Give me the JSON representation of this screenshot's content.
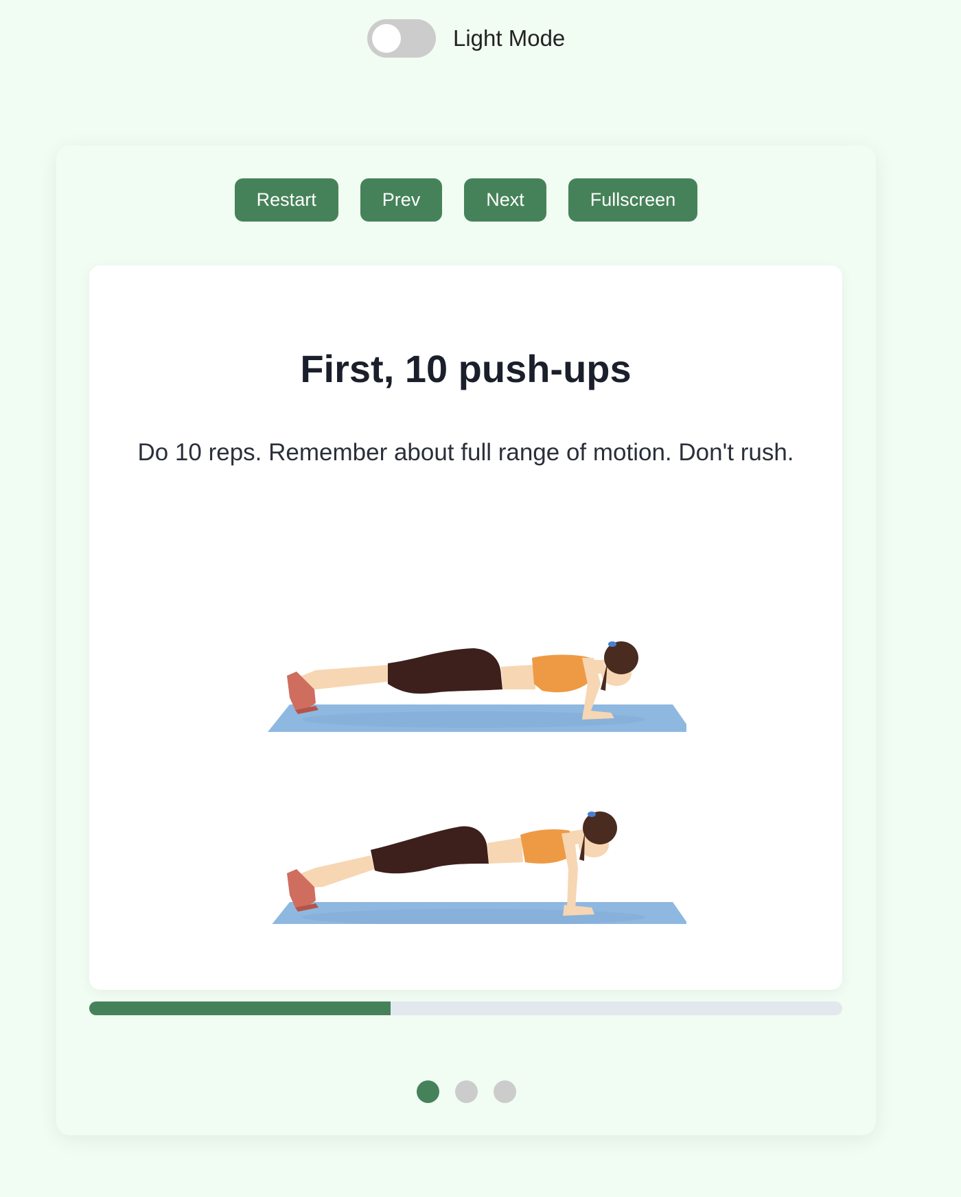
{
  "theme": {
    "label": "Light Mode",
    "enabled": false
  },
  "controls": {
    "restart_label": "Restart",
    "prev_label": "Prev",
    "next_label": "Next",
    "fullscreen_label": "Fullscreen"
  },
  "slide": {
    "title": "First, 10 push-ups",
    "description": "Do 10 reps. Remember about full range of motion. Don't rush.",
    "illustration_icon": "push-up-illustration"
  },
  "progress": {
    "fraction": 0.4
  },
  "pagination": {
    "total": 3,
    "active_index": 0
  },
  "colors": {
    "accent": "#468259",
    "page_background": "#f1fcf2",
    "mat": "#8fb8e0",
    "leggings": "#3d1f1c",
    "top": "#ee9a45",
    "skin": "#f7d6b3",
    "shoes": "#cf6e5f",
    "hair": "#4a2b1f",
    "inactive_dot": "#cccccc",
    "track": "#e3e7ee"
  }
}
